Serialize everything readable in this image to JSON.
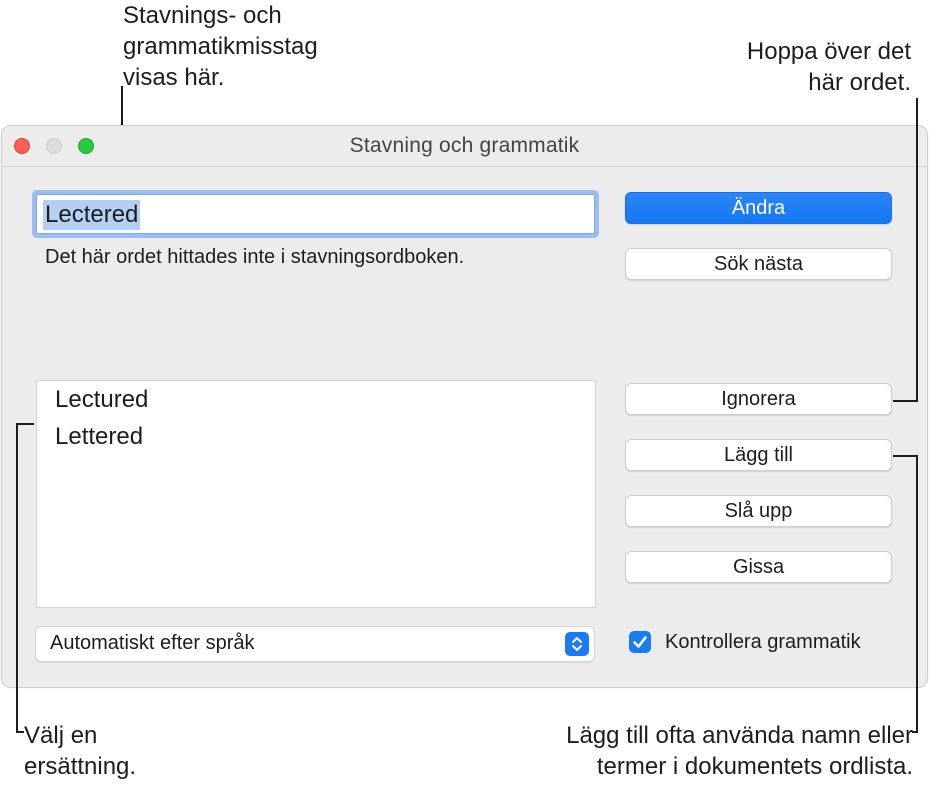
{
  "callouts": {
    "top_left": [
      "Stavnings- och",
      "grammatikmisstag",
      "visas här."
    ],
    "top_right": [
      "Hoppa över det",
      "här ordet."
    ],
    "bottom_left": [
      "Välj en",
      "ersättning."
    ],
    "bottom_right": [
      "Lägg till ofta använda namn eller",
      "termer i dokumentets ordlista."
    ]
  },
  "window": {
    "title": "Stavning och grammatik",
    "misspelled_word": "Lectered",
    "status": "Det här ordet hittades inte i stavningsordboken.",
    "suggestions": [
      "Lectured",
      "Lettered"
    ],
    "language_select": {
      "value": "Automatiskt efter språk",
      "icon": "up-down-chevron-icon"
    },
    "buttons": {
      "change": "Ändra",
      "find_next": "Sök nästa",
      "ignore": "Ignorera",
      "learn": "Lägg till",
      "look_up": "Slå upp",
      "guess": "Gissa"
    },
    "check_grammar": {
      "label": "Kontrollera grammatik",
      "checked": true
    }
  },
  "colors": {
    "accent": "#1a7cf5",
    "close": "#fe5f57",
    "zoom": "#28c840",
    "minimize_inactive": "#dcdcdc",
    "selection": "#b3d0f4"
  }
}
